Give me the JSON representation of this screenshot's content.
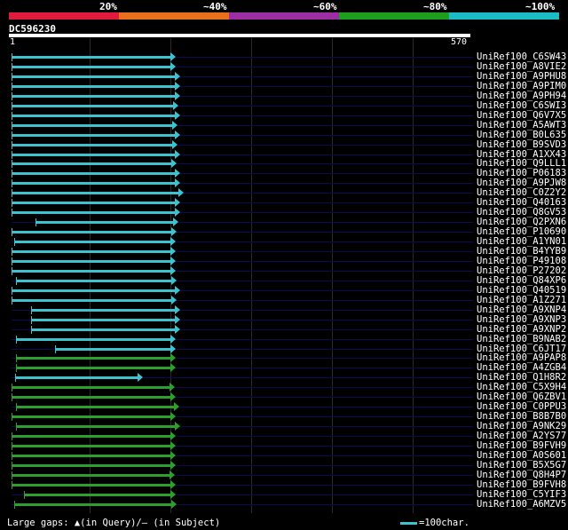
{
  "scale": {
    "labels": [
      "20%",
      "~40%",
      "~60%",
      "~80%",
      "~100%"
    ],
    "colors": [
      "#e01b3c",
      "#e8701c",
      "#9b2ea2",
      "#1d9e1d",
      "#1bbcc5"
    ]
  },
  "query": {
    "name": "DC596230",
    "start": "1",
    "end": "570"
  },
  "hits": [
    {
      "id": "UniRef100_C6SW43",
      "color": "#3cc3cf",
      "s": 1,
      "e": 203
    },
    {
      "id": "UniRef100_A8VIE2",
      "color": "#3cc3cf",
      "s": 1,
      "e": 203
    },
    {
      "id": "UniRef100_A9PHU8",
      "color": "#3cc3cf",
      "s": 1,
      "e": 208
    },
    {
      "id": "UniRef100_A9PIM0",
      "color": "#3cc3cf",
      "s": 1,
      "e": 208
    },
    {
      "id": "UniRef100_A9PH94",
      "color": "#3cc3cf",
      "s": 1,
      "e": 208
    },
    {
      "id": "UniRef100_C6SWI3",
      "color": "#3cc3cf",
      "s": 1,
      "e": 206
    },
    {
      "id": "UniRef100_Q6V7X5",
      "color": "#3cc3cf",
      "s": 1,
      "e": 208
    },
    {
      "id": "UniRef100_A5AWT3",
      "color": "#3cc3cf",
      "s": 1,
      "e": 205
    },
    {
      "id": "UniRef100_B0L635",
      "color": "#3cc3cf",
      "s": 1,
      "e": 208
    },
    {
      "id": "UniRef100_B9SVD3",
      "color": "#3cc3cf",
      "s": 1,
      "e": 205
    },
    {
      "id": "UniRef100_A1XX43",
      "color": "#3cc3cf",
      "s": 1,
      "e": 208
    },
    {
      "id": "UniRef100_Q9LLL1",
      "color": "#3cc3cf",
      "s": 1,
      "e": 204
    },
    {
      "id": "UniRef100_P06183",
      "color": "#3cc3cf",
      "s": 1,
      "e": 208
    },
    {
      "id": "UniRef100_A9PJW8",
      "color": "#3cc3cf",
      "s": 1,
      "e": 208
    },
    {
      "id": "UniRef100_C0Z2Y2",
      "color": "#3cc3cf",
      "s": 1,
      "e": 213
    },
    {
      "id": "UniRef100_Q40163",
      "color": "#3cc3cf",
      "s": 1,
      "e": 208
    },
    {
      "id": "UniRef100_Q8GV53",
      "color": "#3cc3cf",
      "s": 1,
      "e": 208
    },
    {
      "id": "UniRef100_Q2PXN6",
      "color": "#3cc3cf",
      "s": 31,
      "e": 206
    },
    {
      "id": "UniRef100_P10690",
      "color": "#3cc3cf",
      "s": 1,
      "e": 204
    },
    {
      "id": "UniRef100_A1YN01",
      "color": "#3cc3cf",
      "s": 4,
      "e": 203
    },
    {
      "id": "UniRef100_B4YYB9",
      "color": "#3cc3cf",
      "s": 1,
      "e": 203
    },
    {
      "id": "UniRef100_P49108",
      "color": "#3cc3cf",
      "s": 1,
      "e": 203
    },
    {
      "id": "UniRef100_P27202",
      "color": "#3cc3cf",
      "s": 1,
      "e": 203
    },
    {
      "id": "UniRef100_Q84XP6",
      "color": "#3cc3cf",
      "s": 7,
      "e": 204
    },
    {
      "id": "UniRef100_Q40519",
      "color": "#3cc3cf",
      "s": 1,
      "e": 208
    },
    {
      "id": "UniRef100_A1Z271",
      "color": "#3cc3cf",
      "s": 1,
      "e": 204
    },
    {
      "id": "UniRef100_A9XNP4",
      "color": "#3cc3cf",
      "s": 25,
      "e": 208
    },
    {
      "id": "UniRef100_A9XNP3",
      "color": "#3cc3cf",
      "s": 25,
      "e": 208
    },
    {
      "id": "UniRef100_A9XNP2",
      "color": "#3cc3cf",
      "s": 25,
      "e": 208
    },
    {
      "id": "UniRef100_B9NAB2",
      "color": "#3cc3cf",
      "s": 7,
      "e": 203
    },
    {
      "id": "UniRef100_C6JT17",
      "color": "#3cc3cf",
      "s": 55,
      "e": 203
    },
    {
      "id": "UniRef100_A9PAP8",
      "color": "#2ca02c",
      "s": 7,
      "e": 203
    },
    {
      "id": "UniRef100_A4ZGB4",
      "color": "#2ca02c",
      "s": 7,
      "e": 203
    },
    {
      "id": "UniRef100_Q1H8R2",
      "color": "#3cc3cf",
      "s": 5,
      "e": 162
    },
    {
      "id": "UniRef100_C5X9H4",
      "color": "#2ca02c",
      "s": 1,
      "e": 202
    },
    {
      "id": "UniRef100_Q6ZBV1",
      "color": "#2ca02c",
      "s": 1,
      "e": 203
    },
    {
      "id": "UniRef100_C0PPU3",
      "color": "#2ca02c",
      "s": 7,
      "e": 207
    },
    {
      "id": "UniRef100_B8B7B0",
      "color": "#2ca02c",
      "s": 1,
      "e": 203
    },
    {
      "id": "UniRef100_A9NK29",
      "color": "#2ca02c",
      "s": 7,
      "e": 208
    },
    {
      "id": "UniRef100_A2YS77",
      "color": "#2ca02c",
      "s": 1,
      "e": 203
    },
    {
      "id": "UniRef100_B9FVH9",
      "color": "#2ca02c",
      "s": 1,
      "e": 203
    },
    {
      "id": "UniRef100_A0S601",
      "color": "#2ca02c",
      "s": 1,
      "e": 203
    },
    {
      "id": "UniRef100_B5X5G7",
      "color": "#2ca02c",
      "s": 1,
      "e": 203
    },
    {
      "id": "UniRef100_Q8H4P7",
      "color": "#2ca02c",
      "s": 1,
      "e": 202
    },
    {
      "id": "UniRef100_B9FVH8",
      "color": "#2ca02c",
      "s": 1,
      "e": 203
    },
    {
      "id": "UniRef100_C5YIF3",
      "color": "#2ca02c",
      "s": 16,
      "e": 203
    },
    {
      "id": "UniRef100_A6MZV5",
      "color": "#2ca02c",
      "s": 4,
      "e": 204
    }
  ],
  "footer": {
    "text": "Large gaps: ▲(in Query)/— (in Subject)",
    "legend": "=100char."
  }
}
